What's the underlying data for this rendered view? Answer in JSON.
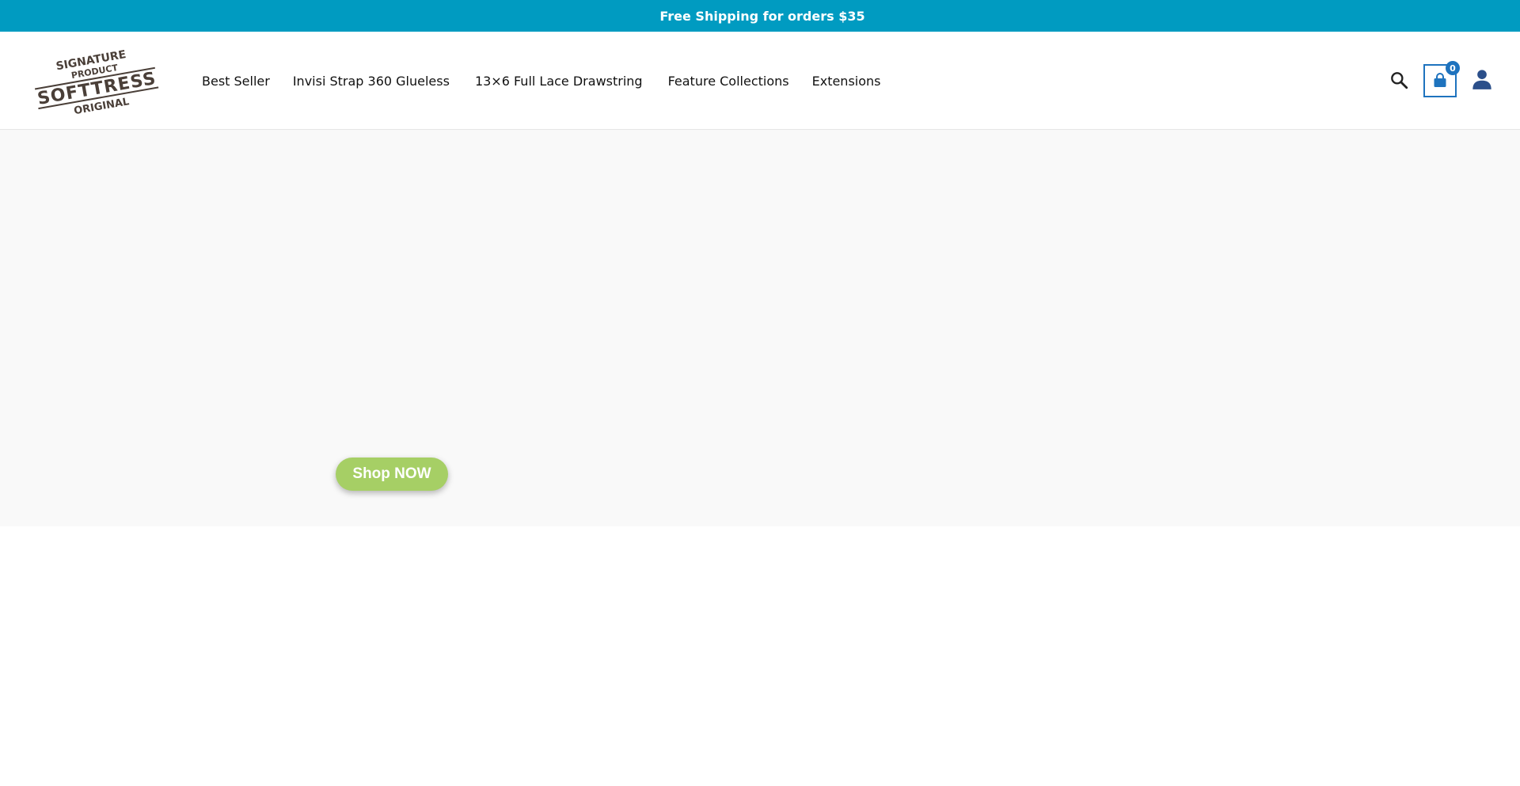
{
  "announcement": {
    "glyph": "",
    "text": "Free Shipping for orders $35"
  },
  "logo": {
    "line1": "SIGNATURE",
    "line2": "PRODUCT",
    "line3": "SOFTTRESS",
    "line4": "ORIGINAL"
  },
  "nav": {
    "items": [
      {
        "label": "Best Seller",
        "has_dropdown": false
      },
      {
        "label": "Invisi Strap 360 Glueless",
        "has_dropdown": true,
        "caret": ""
      },
      {
        "label": "13×6 Full Lace Drawstring",
        "has_dropdown": true,
        "caret": ""
      },
      {
        "label": "Feature Collections",
        "has_dropdown": false
      },
      {
        "label": "Extensions",
        "has_dropdown": false
      }
    ]
  },
  "header_icons": {
    "search": "search-icon",
    "cart": "shopping-bag-icon",
    "cart_count": "0",
    "account": "user-icon"
  },
  "hero": {
    "cta_label": "Shop NOW"
  },
  "colors": {
    "announcement_bg": "#009bc1",
    "cart_accent": "#1e73be",
    "cta_bg": "#a6cf65",
    "hero_bg": "#f9f9f9",
    "logo_color": "#4a3f38"
  }
}
